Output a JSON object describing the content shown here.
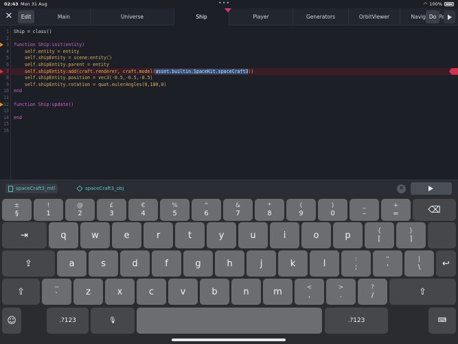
{
  "status": {
    "time": "02:43",
    "date": "Mon 31 Aug",
    "battery": "100%"
  },
  "toolbar": {
    "edit_label": "Edit",
    "do_label": "Do"
  },
  "tabs": [
    {
      "label": "Main"
    },
    {
      "label": "Universe"
    },
    {
      "label": "Ship"
    },
    {
      "label": "Player"
    },
    {
      "label": "Generators"
    },
    {
      "label": "OrbitViewer"
    },
    {
      "label": "NavigationPad"
    }
  ],
  "editor": {
    "lines": [
      {
        "n": "1",
        "t": "Ship = class()"
      },
      {
        "n": "2",
        "t": ""
      },
      {
        "n": "3",
        "t": "function Ship:init(entity)"
      },
      {
        "n": "4",
        "t": "    self.entity = entity"
      },
      {
        "n": "5",
        "t": "    self.shipEntity = scene:entity()"
      },
      {
        "n": "6",
        "t": "    self.shipEntity.parent = entity"
      },
      {
        "n": "7",
        "pre": "    self.shipEntity:add(craft.renderer, craft.model(",
        "sel": "asset.builtin.SpaceKit.spaceCraft3",
        "post": "))"
      },
      {
        "n": "8",
        "t": "    self.shipEntity.position = vec3(-0.5,-0.5,-0.5)"
      },
      {
        "n": "9",
        "t": "    self.shipEntity.rotation = quat.eulerAngles(0,180,0)"
      },
      {
        "n": "10",
        "t": "end"
      },
      {
        "n": "11",
        "t": ""
      },
      {
        "n": "12",
        "t": "function Ship:update()"
      },
      {
        "n": "13",
        "t": ""
      },
      {
        "n": "14",
        "t": "end"
      },
      {
        "n": "15",
        "t": ""
      },
      {
        "n": "16",
        "t": ""
      }
    ]
  },
  "assets": {
    "mtl": "spaceCraft3_mtl",
    "obj": "spaceCraft3_obj"
  },
  "keyboard": {
    "numrow": [
      {
        "top": "±",
        "bot": "§"
      },
      {
        "top": "!",
        "bot": "1"
      },
      {
        "top": "@",
        "bot": "2"
      },
      {
        "top": "£",
        "bot": "3"
      },
      {
        "top": "€",
        "bot": "4"
      },
      {
        "top": "%",
        "bot": "5"
      },
      {
        "top": "^",
        "bot": "6"
      },
      {
        "top": "&",
        "bot": "7"
      },
      {
        "top": "*",
        "bot": "8"
      },
      {
        "top": "(",
        "bot": "9"
      },
      {
        "top": ")",
        "bot": "0"
      },
      {
        "top": "_",
        "bot": "–"
      },
      {
        "top": "+",
        "bot": "="
      }
    ],
    "row1": [
      "q",
      "w",
      "e",
      "r",
      "t",
      "y",
      "u",
      "i",
      "o",
      "p"
    ],
    "row1_extra": [
      {
        "top": "{",
        "bot": "["
      },
      {
        "top": "}",
        "bot": "]"
      }
    ],
    "row2": [
      "a",
      "s",
      "d",
      "f",
      "g",
      "h",
      "j",
      "k",
      "l"
    ],
    "row2_extra": [
      {
        "top": ":",
        "bot": ";"
      },
      {
        "top": "\"",
        "bot": "'"
      },
      {
        "top": "|",
        "bot": "\\"
      }
    ],
    "row3_extra_left": {
      "top": "~",
      "bot": "`"
    },
    "row3": [
      "z",
      "x",
      "c",
      "v",
      "b",
      "n",
      "m"
    ],
    "row3_extra": [
      {
        "top": "<",
        "bot": ","
      },
      {
        "top": ">",
        "bot": "."
      },
      {
        "top": "?",
        "bot": "/"
      }
    ],
    "numbers_label": ".?123"
  }
}
